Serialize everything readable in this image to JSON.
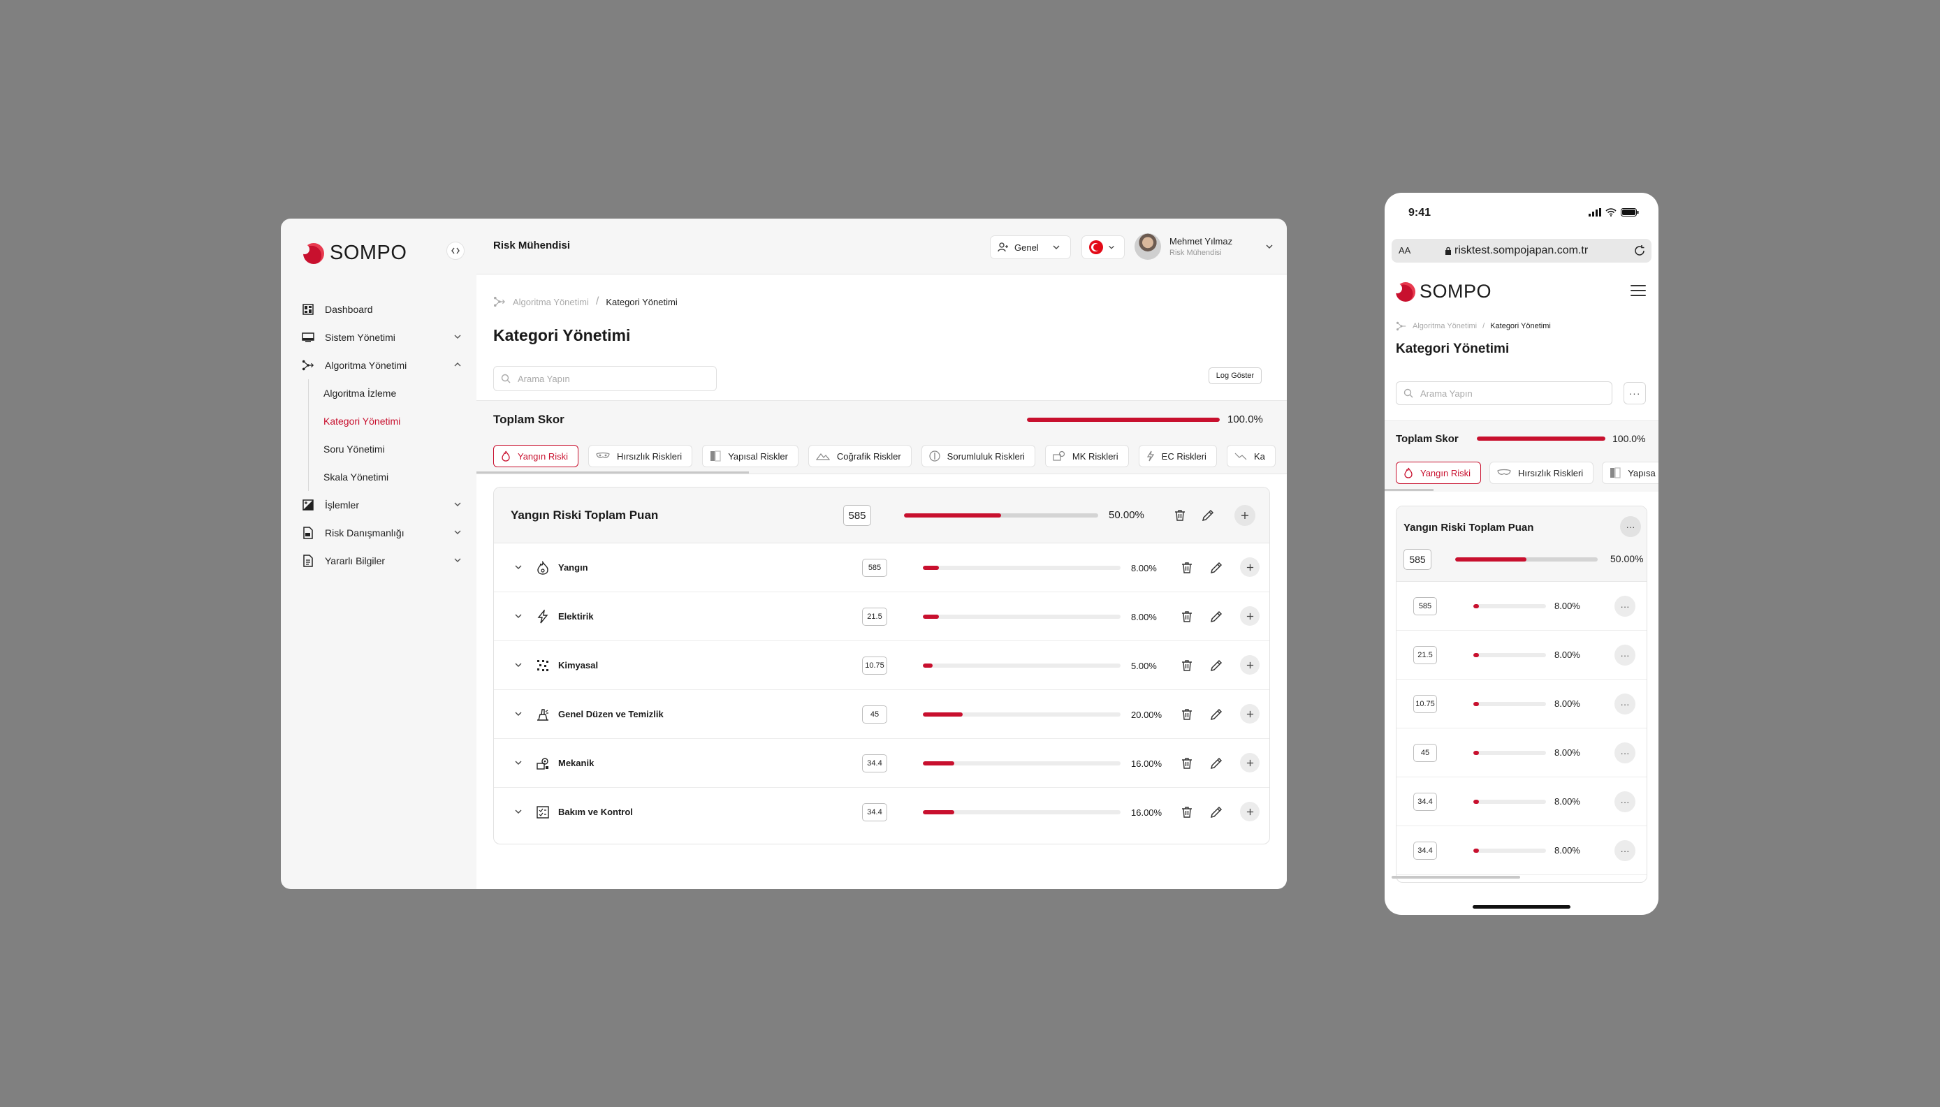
{
  "brand": {
    "name": "SOMPO",
    "accent": "#c8102e"
  },
  "sidebar": {
    "items": [
      {
        "label": "Dashboard",
        "icon": "dashboard-icon"
      },
      {
        "label": "Sistem Yönetimi",
        "icon": "monitor-icon"
      },
      {
        "label": "Algoritma Yönetimi",
        "icon": "algorithm-icon"
      },
      {
        "label": "İşlemler",
        "icon": "transactions-icon"
      },
      {
        "label": "Risk Danışmanlığı",
        "icon": "consulting-icon"
      },
      {
        "label": "Yararlı Bilgiler",
        "icon": "info-doc-icon"
      }
    ],
    "sub_items": [
      "Algoritma İzleme",
      "Kategori Yönetimi",
      "Soru Yönetimi",
      "Skala Yönetimi"
    ],
    "active_sub": "Kategori Yönetimi"
  },
  "header": {
    "role": "Risk Mühendisi",
    "context_select": "Genel",
    "user": {
      "name": "Mehmet Yılmaz",
      "role": "Risk Mühendisi"
    }
  },
  "breadcrumb": {
    "parent": "Algoritma Yönetimi",
    "separator": "/",
    "current": "Kategori Yönetimi"
  },
  "page": {
    "title": "Kategori Yönetimi",
    "search_placeholder": "Arama Yapın",
    "log_button": "Log Göster"
  },
  "total_score": {
    "label": "Toplam Skor",
    "percent_text": "100.0%",
    "fraction": 1.0
  },
  "tabs": [
    "Yangın Riski",
    "Hırsızlık Riskleri",
    "Yapısal Riskler",
    "Coğrafik Riskler",
    "Sorumluluk Riskleri",
    "MK Riskleri",
    "EC Riskleri",
    "Ka"
  ],
  "active_tab": "Yangın Riski",
  "category_card": {
    "title": "Yangın Riski Toplam Puan",
    "score": "585",
    "percent_text": "50.00%",
    "fraction": 0.5,
    "rows": [
      {
        "name": "Yangın",
        "icon": "flame-icon",
        "score": "585",
        "percent_text": "8.00%",
        "fraction": 0.08
      },
      {
        "name": "Elektirik",
        "icon": "lightning-icon",
        "score": "21.5",
        "percent_text": "8.00%",
        "fraction": 0.08
      },
      {
        "name": "Kimyasal",
        "icon": "chemical-icon",
        "score": "10.75",
        "percent_text": "5.00%",
        "fraction": 0.05
      },
      {
        "name": "Genel Düzen ve Temizlik",
        "icon": "cleaning-icon",
        "score": "45",
        "percent_text": "20.00%",
        "fraction": 0.2
      },
      {
        "name": "Mekanik",
        "icon": "mechanical-icon",
        "score": "34.4",
        "percent_text": "16.00%",
        "fraction": 0.16
      },
      {
        "name": "Bakım ve Kontrol",
        "icon": "checklist-icon",
        "score": "34.4",
        "percent_text": "16.00%",
        "fraction": 0.16
      }
    ]
  },
  "mobile": {
    "time": "9:41",
    "url": "risktest.sompojapan.com.tr",
    "aa": "AA",
    "tabs": [
      "Yangın Riski",
      "Hırsızlık Riskleri",
      "Yapısa"
    ],
    "rows": [
      {
        "score": "585",
        "percent_text": "8.00%",
        "fraction": 0.08
      },
      {
        "score": "21.5",
        "percent_text": "8.00%",
        "fraction": 0.08
      },
      {
        "score": "10.75",
        "percent_text": "8.00%",
        "fraction": 0.08
      },
      {
        "score": "45",
        "percent_text": "8.00%",
        "fraction": 0.08
      },
      {
        "score": "34.4",
        "percent_text": "8.00%",
        "fraction": 0.08
      },
      {
        "score": "34.4",
        "percent_text": "8.00%",
        "fraction": 0.08
      }
    ]
  }
}
